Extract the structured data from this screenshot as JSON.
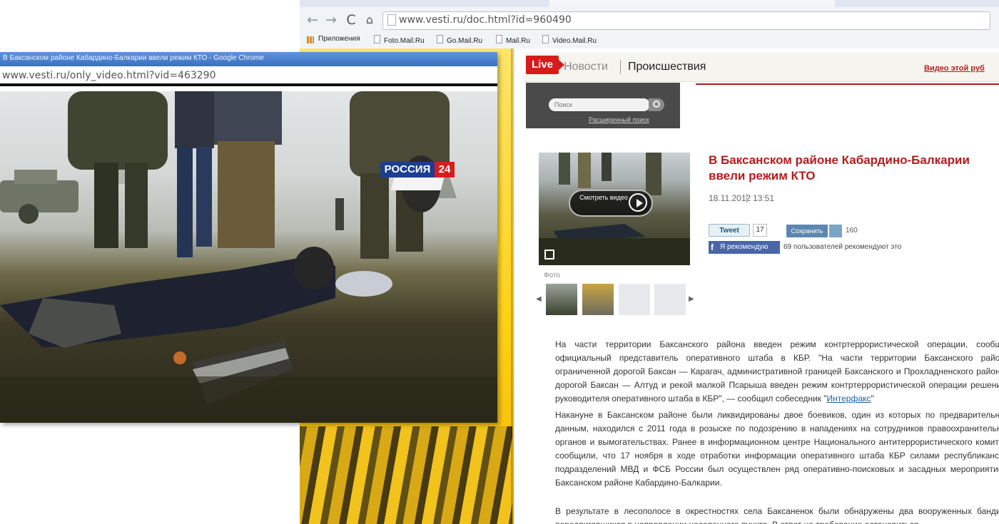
{
  "back_browser": {
    "url": "www.vesti.ru/doc.html?id=960490",
    "bookmarks": [
      "Приложения",
      "Foto.Mail.Ru",
      "Go.Mail.Ru",
      "Mail.Ru",
      "Video.Mail.Ru"
    ]
  },
  "vesti": {
    "live": "Live",
    "nav": {
      "news": "Новости",
      "incidents": "Происшествия"
    },
    "video_link": "Видео этой руб",
    "search": {
      "placeholder": "Поиск",
      "extended": "Расширенный поиск"
    },
    "thumb": {
      "play_label": "Смотреть видео"
    },
    "photos_label": "Фото",
    "headline": "В Баксанском районе Кабардино-Балкарии ввели режим КТО",
    "date": "18.11.2012",
    "time": "13:51",
    "social": {
      "tweet": "Tweet",
      "tweet_count": "17",
      "save": "Сохранить",
      "save_count": "160",
      "fb": "Я рекомендую",
      "fb_text": "69 пользователей рекомендуют это"
    },
    "paragraphs": [
      "На части территории Баксанского района введен режим контртеррористической операции, сообщил официальный представитель оперативного штаба в КБР. \"На части территории Баксанского района, ограниченной дорогой Баксан — Карагач, административной границей Баксанского и Прохладненского районов, дорогой Баксан — Алтуд и рекой малкой Псарыша введен режим контртеррористической операции решением руководителя оперативного штаба в КБР\", — сообщил собеседник \"",
      "Накануне в Баксанском районе были ликвидированы двое боевиков, один из которых по предварительным данным, находился с 2011 года в розыске по подозрению в нападениях на сотрудников правоохранительных органов и вымогательствах. Ранее в информационном центре Национального антитеррористического комитета сообщили, что 17 ноября в ходе отработки информации оперативного штаба КБР силами республиканских подразделений МВД и ФСБ России был осуществлен ряд оперативно-поисковых и засадных мероприятий в Баксанском районе Кабардино-Балкарии.",
      "В результате в лесополосе в окрестностях села Баксаненок были обнаружены два вооруженных бандита, передвигавшихся в направлении населенного пункта. В ответ на требование остановиться"
    ],
    "link": "Интерфакс"
  },
  "popup": {
    "title": "В Баксанском районе Кабардино-Балкарии ввели режим КТО - Google Chrome",
    "url": "www.vesti.ru/only_video.html?vid=463290",
    "logo": {
      "text": "РОССИЯ",
      "num": "24"
    }
  },
  "colors": {
    "accent": "#b21c1c",
    "live": "#d71b1b",
    "title_bar": "#3a6fc2",
    "logo_blue": "#1c3e8f"
  }
}
